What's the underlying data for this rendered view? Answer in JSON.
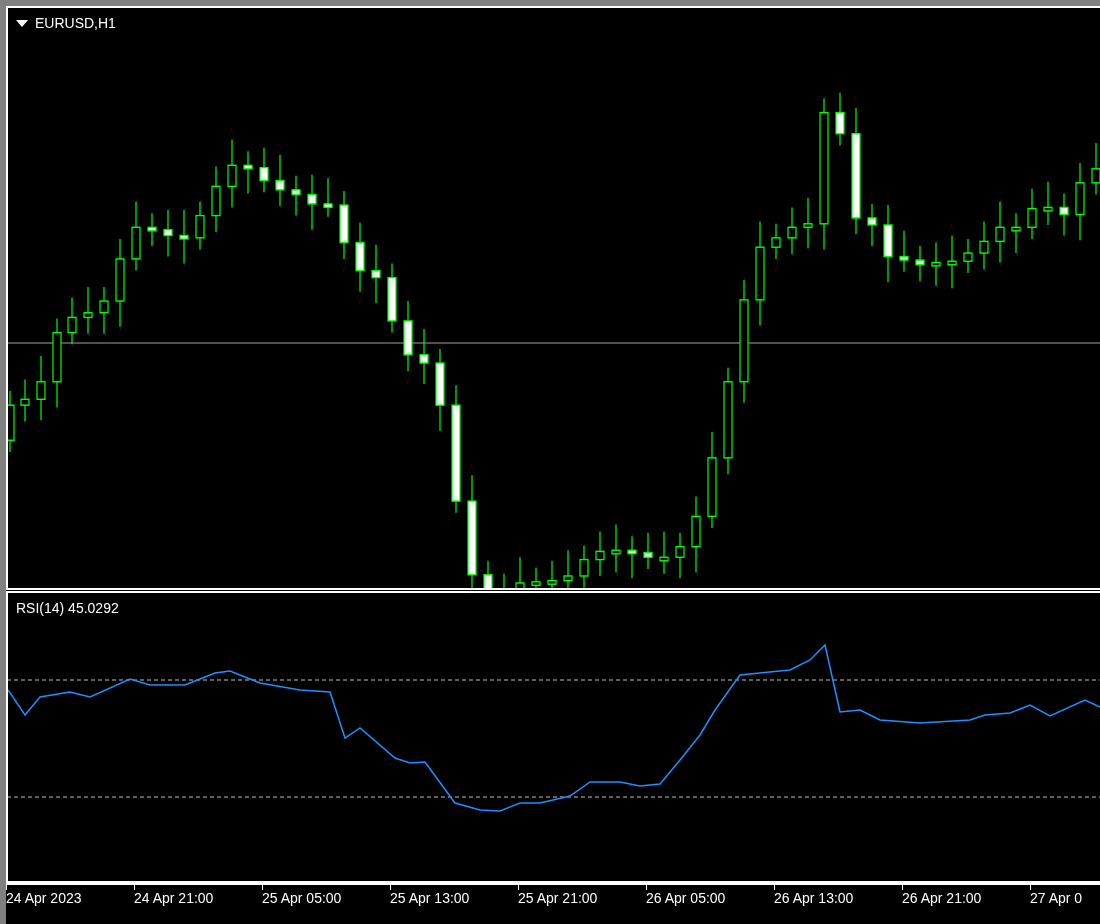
{
  "chart": {
    "symbol": "EURUSD,H1"
  },
  "indicator": {
    "label": "RSI(14) 45.0292"
  },
  "time_axis": {
    "labels": [
      "24 Apr 2023",
      "24 Apr 21:00",
      "25 Apr 05:00",
      "25 Apr 13:00",
      "25 Apr 21:00",
      "26 Apr 05:00",
      "26 Apr 13:00",
      "26 Apr 21:00",
      "27 Apr 0"
    ]
  }
}
